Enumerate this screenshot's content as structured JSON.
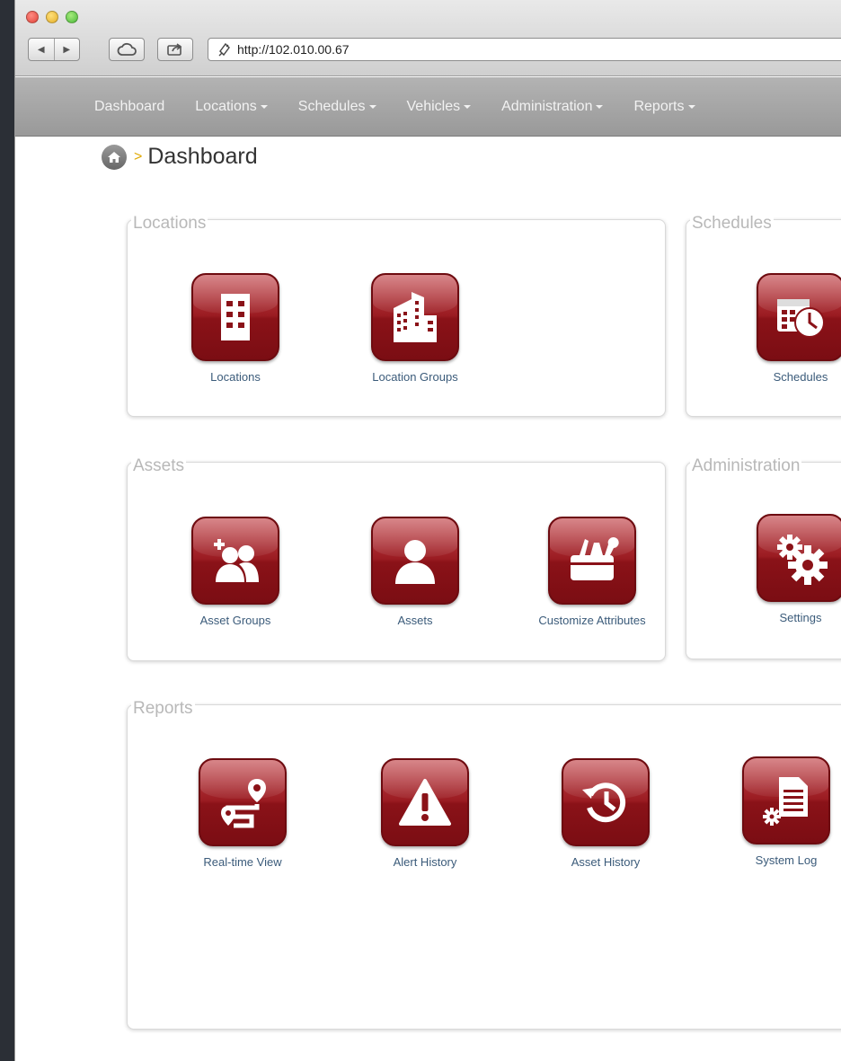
{
  "browser": {
    "url": "http://102.010.00.67",
    "back_glyph": "◀",
    "forward_glyph": "▶"
  },
  "nav": {
    "items": [
      {
        "label": "Dashboard",
        "dropdown": false
      },
      {
        "label": "Locations",
        "dropdown": true
      },
      {
        "label": "Schedules",
        "dropdown": true
      },
      {
        "label": "Vehicles",
        "dropdown": true
      },
      {
        "label": "Administration",
        "dropdown": true
      },
      {
        "label": "Reports",
        "dropdown": true
      }
    ]
  },
  "breadcrumb": {
    "separator": ">",
    "title": "Dashboard"
  },
  "panels": {
    "locations": {
      "title": "Locations",
      "tiles": [
        {
          "label": "Locations",
          "icon": "building-icon"
        },
        {
          "label": "Location Groups",
          "icon": "city-buildings-icon"
        }
      ]
    },
    "schedules": {
      "title": "Schedules",
      "tiles": [
        {
          "label": "Schedules",
          "icon": "calendar-clock-icon"
        }
      ]
    },
    "assets": {
      "title": "Assets",
      "tiles": [
        {
          "label": "Asset Groups",
          "icon": "add-group-icon"
        },
        {
          "label": "Assets",
          "icon": "person-icon"
        },
        {
          "label": "Customize Attributes",
          "icon": "toolbox-icon"
        }
      ]
    },
    "administration": {
      "title": "Administration",
      "tiles": [
        {
          "label": "Settings",
          "icon": "gears-icon"
        }
      ]
    },
    "reports": {
      "title": "Reports",
      "tiles": [
        {
          "label": "Real-time View",
          "icon": "route-pin-icon"
        },
        {
          "label": "Alert History",
          "icon": "warning-icon"
        },
        {
          "label": "Asset History",
          "icon": "history-icon"
        },
        {
          "label": "System Log",
          "icon": "document-gear-icon"
        }
      ]
    }
  },
  "colors": {
    "tile_red": "#9b1c22",
    "label_blue": "#3b5b7a",
    "legend_gray": "#b8b8b8"
  }
}
